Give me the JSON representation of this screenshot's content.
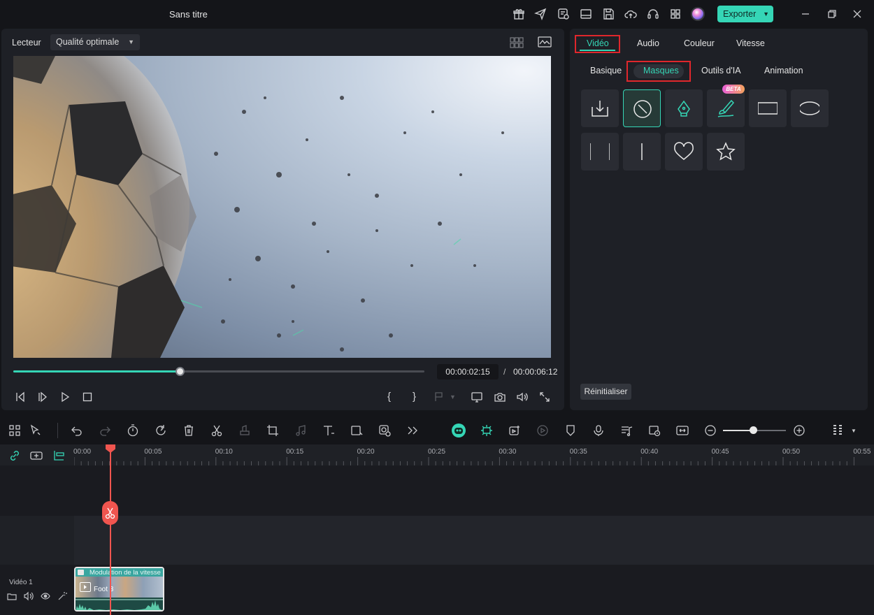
{
  "window": {
    "title": "Sans titre"
  },
  "header": {
    "export_label": "Exporter"
  },
  "player": {
    "label": "Lecteur",
    "quality": "Qualité optimale",
    "current_time": "00:00:02:15",
    "separator": "/",
    "total_time": "00:00:06:12",
    "progress_fraction": 0.405
  },
  "properties": {
    "tabs": [
      "Vidéo",
      "Audio",
      "Couleur",
      "Vitesse"
    ],
    "subtabs": [
      "Basique",
      "Masques",
      "Outils d'IA",
      "Animation"
    ],
    "beta_badge": "BETA",
    "reset_label": "Réinitialiser"
  },
  "timeline": {
    "ticks": [
      "00:00",
      "00:05",
      "00:10",
      "00:15",
      "00:20",
      "00:25",
      "00:30",
      "00:35",
      "00:40",
      "00:45",
      "00:50",
      "00:55"
    ],
    "track_label": "Vidéo 1",
    "clip_title": "Modulation de la vitesse",
    "clip_name": "Foot 3"
  },
  "colors": {
    "accent": "#35d6b6",
    "highlight_box": "#e0272c",
    "playhead": "#f0554f"
  }
}
